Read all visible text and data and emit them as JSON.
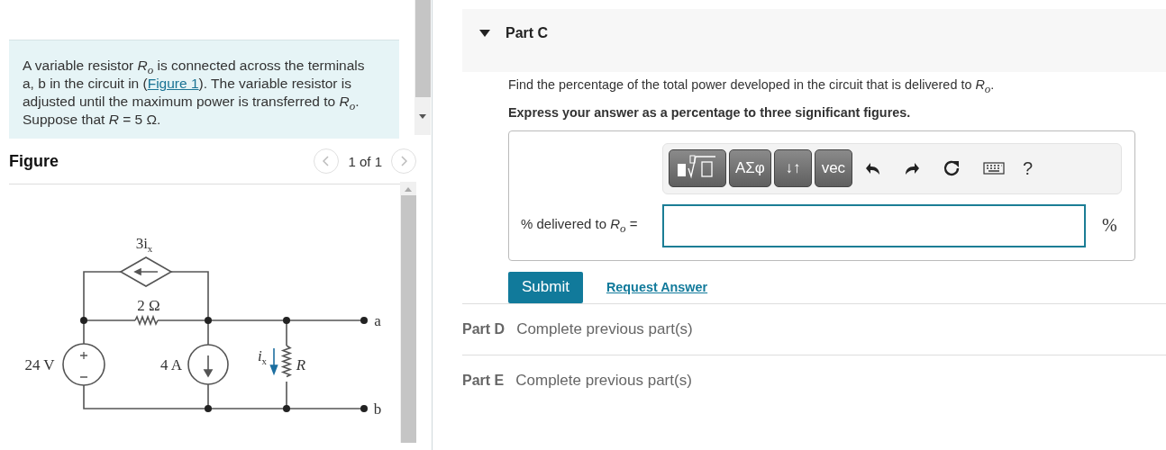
{
  "problem": {
    "text_before": "A variable resistor *R*$_{o}$ is connected across the terminals a, b in the circuit in (",
    "link": "Figure 1",
    "text_after": "). The variable resistor is adjusted until the maximum power is transferred to *R*$_{o}$. Suppose that *R* = 5 Ω."
  },
  "figure": {
    "title": "Figure",
    "pager": "1 of 1",
    "labels": [
      {
        "kind": "dep",
        "text": "3i$_{x}$"
      },
      {
        "kind": "res",
        "text": "2 Ω"
      },
      {
        "kind": "vsrc",
        "text": "24 V"
      },
      {
        "kind": "isrc",
        "text": "4 A"
      },
      {
        "kind": "ix",
        "text": "*i*$_{x}$"
      },
      {
        "kind": "rload",
        "text": "*R*"
      },
      {
        "kind": "ta",
        "text": "a"
      },
      {
        "kind": "tb",
        "text": "b"
      }
    ]
  },
  "part_c": {
    "title": "Part C",
    "expanded": true,
    "question": "Find the percentage of the total power developed in the circuit that is delivered to *R*$_{o}$.",
    "instruction": "Express your answer as a percentage to three significant figures.",
    "toolbar": [
      {
        "kind": "dark",
        "label": "ΑΣφ"
      },
      {
        "kind": "dark",
        "label": "↓↑"
      },
      {
        "kind": "dark",
        "label": "vec"
      },
      {
        "kind": "help",
        "label": "?"
      }
    ],
    "answer_label": "% delivered to *R*$_{o}$ =",
    "unit": "%",
    "submit": "Submit",
    "request": "Request Answer"
  },
  "parts": [
    {
      "title": "Part D",
      "status": "Complete previous part(s)"
    },
    {
      "title": "Part E",
      "status": "Complete previous part(s)"
    }
  ]
}
